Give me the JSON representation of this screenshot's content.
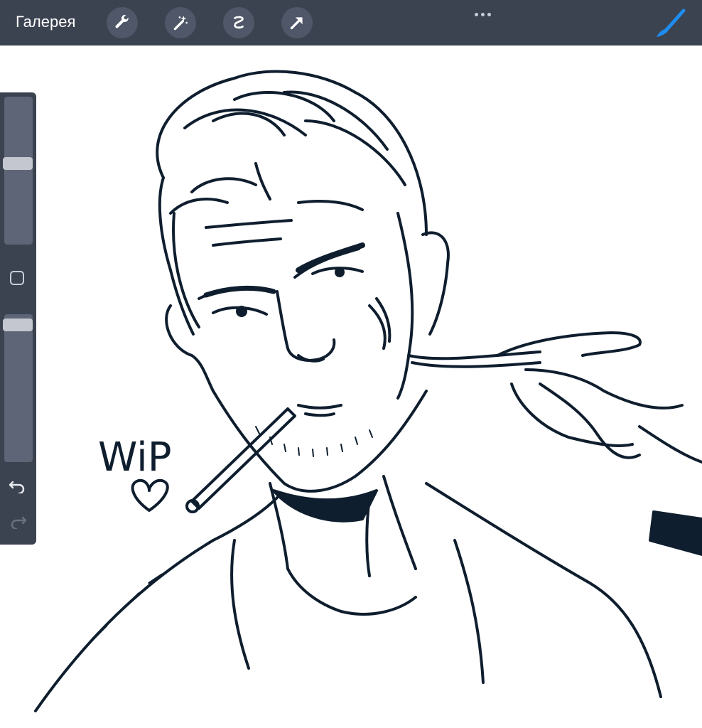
{
  "topbar": {
    "gallery_label": "Галерея",
    "tools": [
      {
        "icon": "wrench-icon",
        "name": "actions"
      },
      {
        "icon": "magic-wand-icon",
        "name": "adjustments"
      },
      {
        "icon": "selection-icon",
        "name": "selection"
      },
      {
        "icon": "transform-arrow-icon",
        "name": "transform"
      }
    ],
    "more_icon": "more-dots-icon",
    "brush_icon": "brush-icon",
    "accent": "#1e8cf0"
  },
  "sidebar": {
    "brush_size_level": 0.55,
    "opacity_level": 0.97,
    "modifier_icon": "square-modifier-icon",
    "undo_icon": "undo-icon",
    "redo_icon": "redo-icon"
  },
  "canvas": {
    "annotation": "WiP",
    "heart_icon": "heart-icon",
    "line_color": "#0f1e2e",
    "background": "#ffffff"
  }
}
